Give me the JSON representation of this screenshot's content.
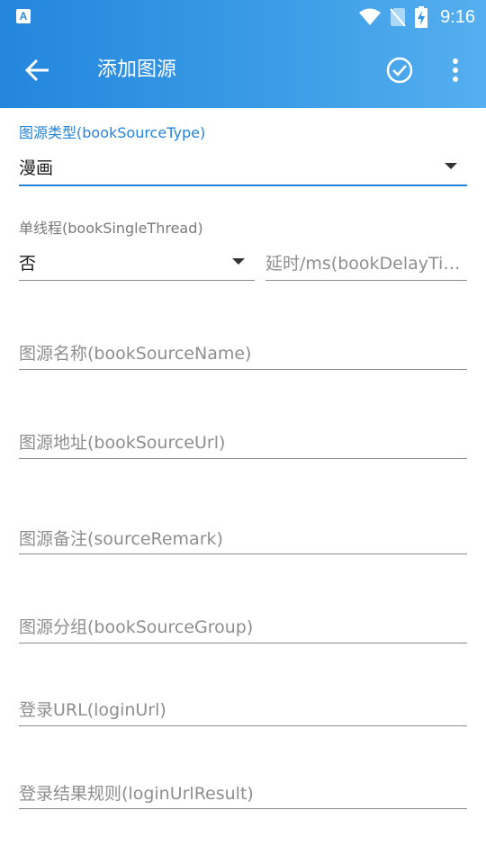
{
  "status_bar": {
    "left_icon": "A",
    "time": "9:16",
    "icons": [
      "wifi-icon",
      "no-sim-icon",
      "battery-charging-icon"
    ]
  },
  "app_bar": {
    "title": "添加图源",
    "icons": [
      "back-arrow-icon",
      "check-circle-icon",
      "more-vert-icon"
    ]
  },
  "form": {
    "source_type": {
      "label": "图源类型(bookSourceType)",
      "value": "漫画"
    },
    "single_thread": {
      "label": "单线程(bookSingleThread)",
      "value": "否"
    },
    "delay_time": {
      "placeholder": "延时/ms(bookDelayTime)"
    },
    "source_name": {
      "placeholder": "图源名称(bookSourceName)"
    },
    "source_url": {
      "placeholder": "图源地址(bookSourceUrl)"
    },
    "source_remark": {
      "placeholder": "图源备注(sourceRemark)"
    },
    "source_group": {
      "placeholder": "图源分组(bookSourceGroup)"
    },
    "login_url": {
      "placeholder": "登录URL(loginUrl)"
    },
    "login_url_result": {
      "placeholder": "登录结果规则(loginUrlResult)"
    }
  },
  "colors": {
    "app_bar": "#3d9de6",
    "accent": "#2583d9"
  }
}
